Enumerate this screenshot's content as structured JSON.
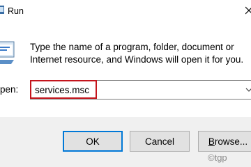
{
  "window": {
    "title": "Run"
  },
  "description": "Type the name of a program, folder, document or Internet resource, and Windows will open it for you.",
  "open_field": {
    "label": "pen:",
    "value": "services.msc"
  },
  "buttons": {
    "ok": "OK",
    "cancel": "Cancel",
    "browse_accel": "B",
    "browse_rest": "rowse..."
  },
  "watermark": "©tgp",
  "colors": {
    "highlight": "#c4141c",
    "default_button_border": "#0078d7",
    "footer_bg": "#f0f0f0"
  }
}
